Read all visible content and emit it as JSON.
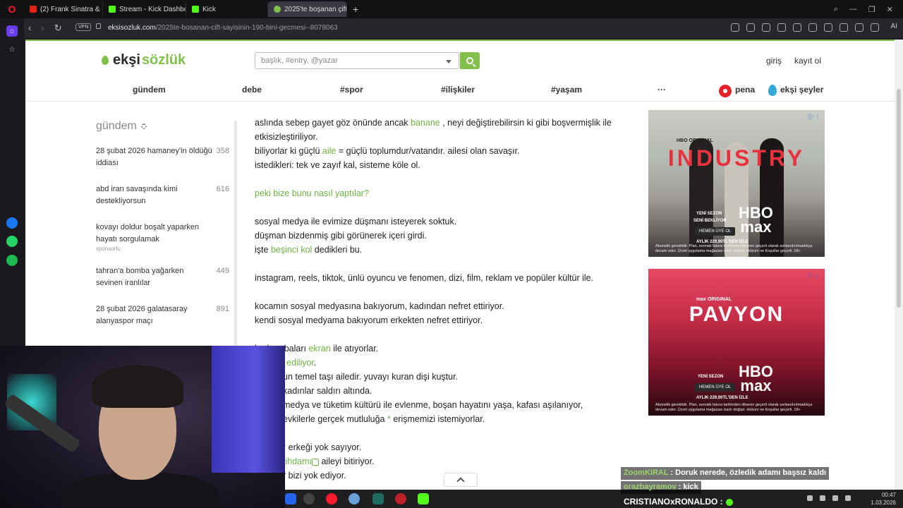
{
  "browser": {
    "tabs": [
      {
        "label": "(2) Frank Sinatra & Nat K...",
        "color": "#e62117"
      },
      {
        "label": "Stream - Kick Dashboard",
        "color": "#53fc18"
      },
      {
        "label": "Kick",
        "color": "#53fc18"
      },
      {
        "label": "2025'te boşanan çift sayısı...",
        "color": "#81c14b"
      }
    ],
    "new_tab": "+",
    "vpn": "VPN",
    "url_domain": "eksisozluk.com",
    "url_path": "/2025te-bosanan-cift-sayisinin-190-bini-gecmesi--8078063",
    "ai_label": "AI"
  },
  "site": {
    "logo_prefix": "ekşi",
    "logo_suffix": "sözlük",
    "search_placeholder": "başlık, #entry, @yazar",
    "login": "giriş",
    "register": "kayıt ol",
    "nav": [
      "gündem",
      "debe",
      "#spor",
      "#ilişkiler",
      "#yaşam",
      "···"
    ],
    "pena": "pena",
    "seyler": "ekşi şeyler"
  },
  "sidebar": {
    "title": "gündem",
    "topics": [
      {
        "title": "28 şubat 2026 hamaney'in öldüğü iddiası",
        "count": "358",
        "sponsored": ""
      },
      {
        "title": "abd iran savaşında kimi destekliyorsun",
        "count": "616",
        "sponsored": ""
      },
      {
        "title": "kovayı doldur boşalt yaparken hayatı sorgulamak",
        "count": "",
        "sponsored": "sponsorlu"
      },
      {
        "title": "tahran'a bomba yağarken sevinen iranlılar",
        "count": "449",
        "sponsored": ""
      },
      {
        "title": "28 şubat 2026 galatasaray alanyaspor maçı",
        "count": "891",
        "sponsored": ""
      }
    ]
  },
  "entry": {
    "line1a": "aslında sebep gayet göz önünde ancak",
    "line1_link": "banane",
    "line1b": ", neyi değiştirebilirsin ki gibi boşvermişlik ile",
    "line2": "etkisizleştiriliyor.",
    "line3a": "biliyorlar ki güçlü",
    "line3_link": "aile",
    "line3b": "= güçlü toplumdur/vatandır. ailesi olan savaşır.",
    "line4": "istedikleri: tek ve zayıf kal, sisteme köle ol.",
    "question": "peki bize bunu nasıl yaptılar?",
    "line6": "sosyal medya ile evimize düşmanı isteyerek soktuk.",
    "line7": "düşman bizdenmiş gibi görünerek içeri girdi.",
    "line8a": "işte",
    "line8_link": "beşinci kol",
    "line8b": "dedikleri bu.",
    "line9": "instagram, reels, tiktok, ünlü oyuncu ve fenomen, dizi, film, reklam ve popüler kültür ile.",
    "line10": "kocamın sosyal medyasına bakıyorum, kadından nefret ettiriyor.",
    "line11": "kendi sosyal medyama bakıyorum erkekten nefret ettiriyor.",
    "line12a": "bu bombaları",
    "line12_link": "ekran",
    "line12b": "ile atıyorlar.",
    "line13_link": "ediliyor",
    "line13b": ".",
    "line14": "un temel taşı ailedir. yuvayı kuran dişi kuştur.",
    "line15": "kadınlar saldırı altında.",
    "line16": "medya ve tüketim kültürü ile evlenme, boşan hayatını yaşa, kafası aşılanıyor,",
    "line17a": "evkilerle gerçek mutluluğa",
    "line17_star": "*",
    "line17b": "erişmemizi istemiyorlar.",
    "line18_link": "r",
    "line18b": "erkeği yok sayıyor.",
    "line19_link": "tihdamı",
    "line19b": "aileyi bitiriyor.",
    "line20a": "r",
    "line20b": "bizi yok ediyor."
  },
  "ads": {
    "industry": {
      "brand": "HBO ORIGINAL",
      "title": "INDUSTRY",
      "line1": "YENİ SEZON",
      "line2": "SENİ BEKLİYOR",
      "button": "HEMEN ÜYE OL",
      "price": "AYLIK 229,90TL'DEN İZLE",
      "hbo": "HBO",
      "max": "max",
      "fine": "Abonelik gereklidir. Plan, sonraki fatura tarihinden itibaren geçerli olarak sonlandırılmadıkça devam eder. Ücret uygulama mağazası bazlı değişir. Hüküm ve Koşullar geçerli. 18+"
    },
    "pavyon": {
      "brand": "max ORIGINAL",
      "title": "PAVYON",
      "line1": "YENİ SEZON",
      "button": "HEMEN ÜYE OL",
      "price": "AYLIK 229,90TL'DEN İZLE",
      "hbo": "HBO",
      "max": "max",
      "fine": "Abonelik gereklidir. Plan, sonraki fatura tarihinden itibaren geçerli olarak sonlandırılmadıkça devam eder. Ücret uygulama mağazası bazlı değişir. Hüküm ve Koşullar geçerli. 18+"
    }
  },
  "chat": {
    "msg1_user": "ZoomKIRAL",
    "msg1_text": ": Doruk nerede, özledik adamı başsız kaldı",
    "msg2_user": "orazbayramov",
    "msg2_text": ": kick",
    "msg3": "CRISTIANOxRONALDO :"
  },
  "taskbar": {
    "time": "00:47",
    "date": "1.03.2026"
  }
}
